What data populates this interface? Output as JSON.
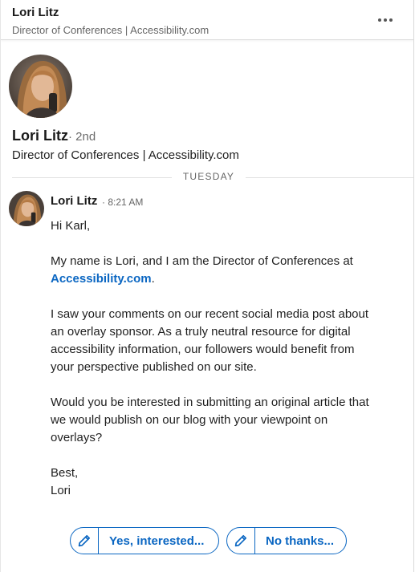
{
  "header": {
    "name": "Lori Litz",
    "subtitle": "Director of Conferences | Accessibility.com",
    "more_icon": "more-horizontal-icon"
  },
  "profile": {
    "name": "Lori Litz",
    "degree": "· 2nd",
    "headline": "Director of Conferences | Accessibility.com"
  },
  "divider": {
    "day": "TUESDAY"
  },
  "message": {
    "sender": "Lori Litz",
    "time": "· 8:21 AM",
    "greeting": "Hi Karl,",
    "p1_before": "My name is Lori, and I am the Director of Conferences at ",
    "p1_link": "Accessibility.com",
    "p1_after": ".",
    "p2": "I saw your comments on our recent social media post about an overlay sponsor. As a truly neutral resource for digital accessibility information, our followers would benefit from your perspective published on our site.",
    "p3": "Would you be interested in submitting an original article that we would publish on our blog with your viewpoint on overlays?",
    "closing": "Best,",
    "signature": "Lori"
  },
  "replies": [
    {
      "label": "Yes, interested...",
      "icon": "pencil-icon"
    },
    {
      "label": "No thanks...",
      "icon": "pencil-icon"
    }
  ],
  "colors": {
    "accent": "#0a66c2",
    "muted_text": "#666666"
  }
}
